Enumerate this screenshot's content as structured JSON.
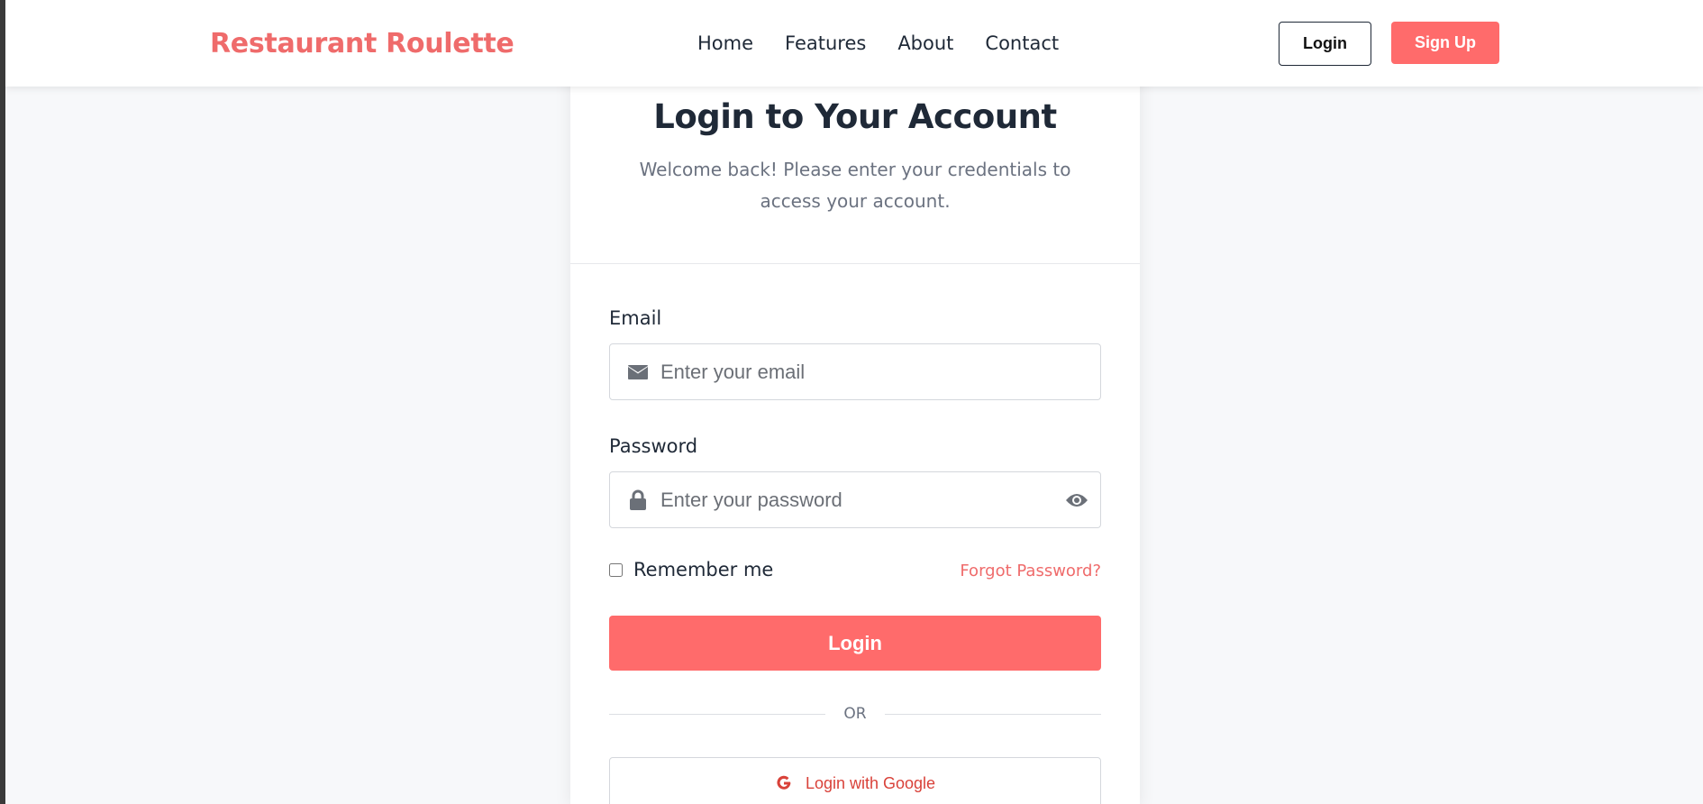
{
  "navbar": {
    "brand": "Restaurant Roulette",
    "links": [
      "Home",
      "Features",
      "About",
      "Contact"
    ],
    "login_label": "Login",
    "signup_label": "Sign Up"
  },
  "card": {
    "title": "Login to Your Account",
    "subtitle": "Welcome back! Please enter your credentials to access your account.",
    "email": {
      "label": "Email",
      "placeholder": "Enter your email",
      "icon": "envelope-icon"
    },
    "password": {
      "label": "Password",
      "placeholder": "Enter your password",
      "icon": "lock-icon",
      "toggle_icon": "eye-icon"
    },
    "remember_label": "Remember me",
    "forgot_label": "Forgot Password?",
    "login_button": "Login",
    "divider_text": "OR",
    "google_button": "Login with Google"
  },
  "colors": {
    "accent": "#ff6b6b",
    "brand_text": "#ef6b6b",
    "google_red": "#d9423a",
    "text_dark": "#1f2937",
    "text_muted": "#6b7280",
    "page_bg": "#f7f8fa"
  }
}
